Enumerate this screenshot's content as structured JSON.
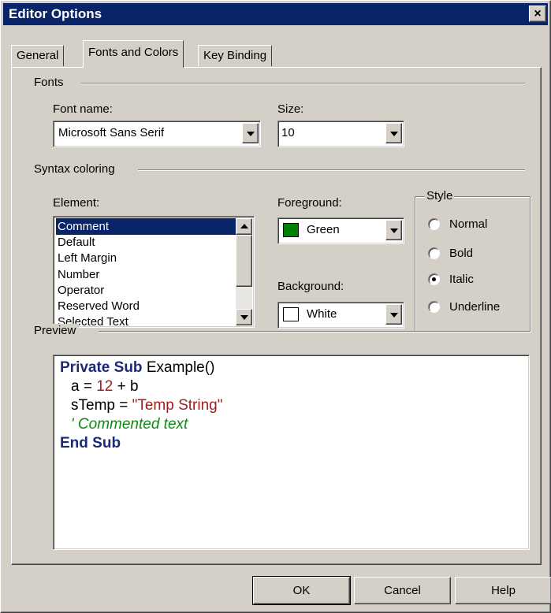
{
  "window": {
    "title": "Editor Options",
    "close_label": "×"
  },
  "tabs": [
    {
      "label": "General"
    },
    {
      "label": "Fonts and Colors"
    },
    {
      "label": "Key Binding"
    }
  ],
  "fonts": {
    "group_label": "Fonts",
    "font_name_label": "Font name:",
    "font_name_value": "Microsoft Sans Serif",
    "size_label": "Size:",
    "size_value": "10"
  },
  "syntax": {
    "group_label": "Syntax coloring",
    "element_label": "Element:",
    "elements": [
      "Comment",
      "Default",
      "Left Margin",
      "Number",
      "Operator",
      "Reserved Word",
      "Selected Text"
    ],
    "selected_element": "Comment",
    "foreground_label": "Foreground:",
    "foreground_value": "Green",
    "foreground_color": "#008000",
    "background_label": "Background:",
    "background_value": "White",
    "background_color": "#ffffff",
    "style_label": "Style",
    "styles": [
      {
        "label": "Normal",
        "checked": false
      },
      {
        "label": "Bold",
        "checked": false
      },
      {
        "label": "Italic",
        "checked": true
      },
      {
        "label": "Underline",
        "checked": false
      }
    ]
  },
  "preview": {
    "group_label": "Preview",
    "line1_kw": "Private Sub",
    "line1_rest": " Example()",
    "line2_a": "a = ",
    "line2_num": "12",
    "line2_b": " + b",
    "line3_a": "sTemp = ",
    "line3_str": "\"Temp String\"",
    "line4_comment": "' Commented text",
    "line5_kw": "End Sub",
    "colors": {
      "keyword": "#1c2a7a",
      "number": "#a02020",
      "string": "#a02020",
      "comment": "#118811"
    }
  },
  "buttons": {
    "ok": "OK",
    "cancel": "Cancel",
    "help": "Help"
  }
}
